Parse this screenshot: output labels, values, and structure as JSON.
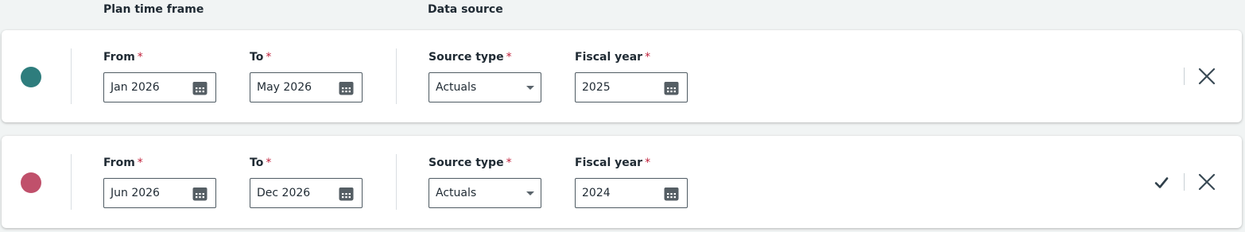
{
  "headers": {
    "plan_time_frame": "Plan time frame",
    "data_source": "Data source"
  },
  "labels": {
    "from": "From",
    "to": "To",
    "source_type": "Source type",
    "fiscal_year": "Fiscal year",
    "required_marker": "*"
  },
  "rows": [
    {
      "dot_color": "#2e7d7d",
      "from": "Jan 2026",
      "to": "May 2026",
      "source_type": "Actuals",
      "fiscal_year": "2025",
      "show_check": false
    },
    {
      "dot_color": "#c0506b",
      "from": "Jun 2026",
      "to": "Dec 2026",
      "source_type": "Actuals",
      "fiscal_year": "2024",
      "show_check": true
    }
  ],
  "icons": {
    "calendar": "calendar-icon",
    "dropdown": "chevron-down-icon",
    "close": "close-icon",
    "confirm": "checkmark-icon"
  },
  "colors": {
    "required": "#c0203a",
    "border": "#4f5b63",
    "icon": "#3a4a55"
  }
}
